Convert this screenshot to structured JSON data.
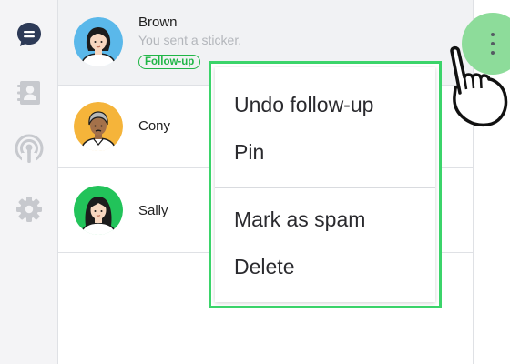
{
  "sidebar": {
    "items": [
      {
        "icon": "chat-bubble-icon",
        "active": true
      },
      {
        "icon": "contacts-icon",
        "active": false
      },
      {
        "icon": "broadcast-icon",
        "active": false
      },
      {
        "icon": "gear-icon",
        "active": false
      }
    ]
  },
  "chats": [
    {
      "name": "Brown",
      "preview": "You sent a sticker.",
      "tag": "Follow-up",
      "avatar_bg": "#5ab8ea",
      "selected": true
    },
    {
      "name": "Cony",
      "preview": "",
      "tag": "",
      "avatar_bg": "#f5b43a",
      "selected": false
    },
    {
      "name": "Sally",
      "preview": "",
      "tag": "",
      "avatar_bg": "#22c35a",
      "selected": false
    }
  ],
  "context_menu": {
    "group1": [
      "Undo follow-up",
      "Pin"
    ],
    "group2": [
      "Mark as spam",
      "Delete"
    ]
  },
  "colors": {
    "accent_green": "#20b646",
    "highlight_border": "#3bd46a",
    "ripple": "#8ddc9a"
  }
}
